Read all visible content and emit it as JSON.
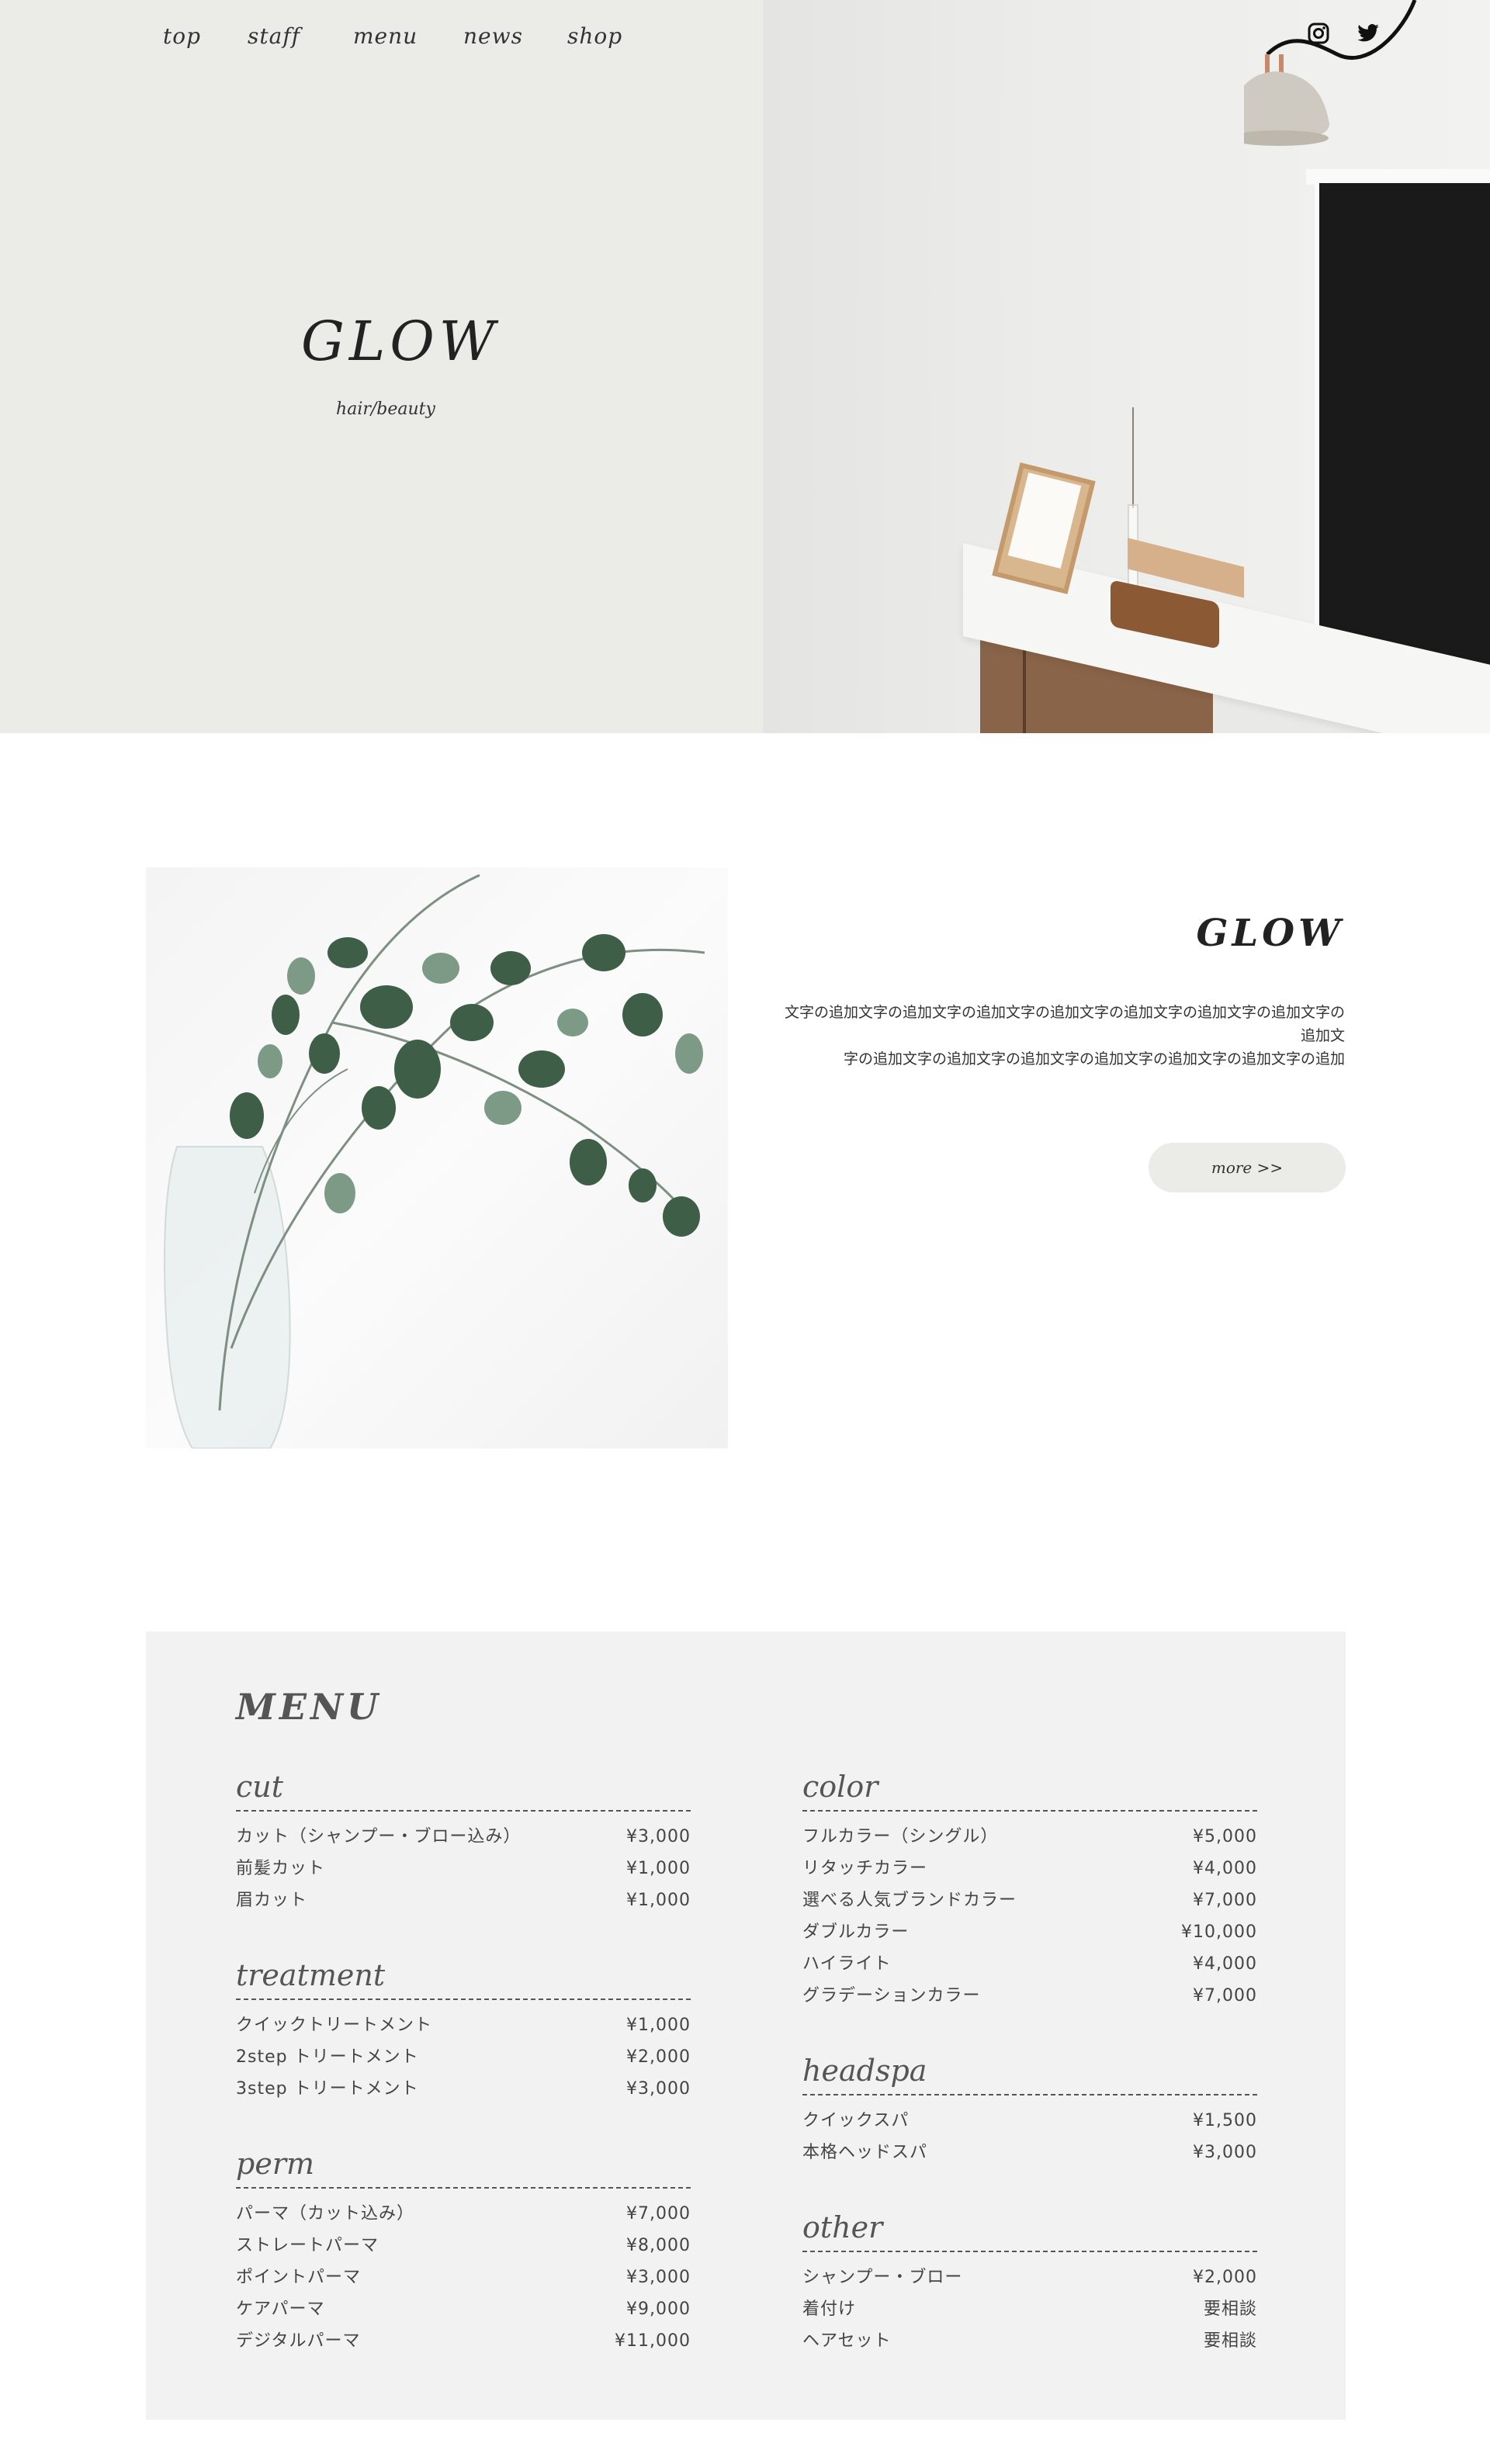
{
  "nav": {
    "items": [
      "top",
      "staff",
      "menu",
      "news",
      "shop"
    ]
  },
  "social": {
    "icons": [
      "instagram-icon",
      "twitter-icon"
    ]
  },
  "hero": {
    "title": "GLOW",
    "subtitle": "hair/beauty"
  },
  "about": {
    "title": "GLOW",
    "text_line1": "文字の追加文字の追加文字の追加文字の追加文字の追加文字の追加文字の追加文字の追加文",
    "text_line2": "字の追加文字の追加文字の追加文字の追加文字の追加文字の追加文字の追加",
    "more_label": "more >>"
  },
  "menu": {
    "heading": "MENU",
    "left": [
      {
        "title": "cut",
        "items": [
          {
            "name": "カット（シャンプー・ブロー込み）",
            "price": "¥3,000"
          },
          {
            "name": "前髪カット",
            "price": "¥1,000"
          },
          {
            "name": "眉カット",
            "price": "¥1,000"
          }
        ]
      },
      {
        "title": "treatment",
        "items": [
          {
            "name": "クイックトリートメント",
            "price": "¥1,000"
          },
          {
            "name": "2step トリートメント",
            "price": "¥2,000"
          },
          {
            "name": "3step トリートメント",
            "price": "¥3,000"
          }
        ]
      },
      {
        "title": "perm",
        "items": [
          {
            "name": "パーマ（カット込み）",
            "price": "¥7,000"
          },
          {
            "name": "ストレートパーマ",
            "price": "¥8,000"
          },
          {
            "name": "ポイントパーマ",
            "price": "¥3,000"
          },
          {
            "name": "ケアパーマ",
            "price": "¥9,000"
          },
          {
            "name": "デジタルパーマ",
            "price": "¥11,000"
          }
        ]
      }
    ],
    "right": [
      {
        "title": "color",
        "items": [
          {
            "name": "フルカラー（シングル）",
            "price": "¥5,000"
          },
          {
            "name": "リタッチカラー",
            "price": "¥4,000"
          },
          {
            "name": "選べる人気ブランドカラー",
            "price": "¥7,000"
          },
          {
            "name": "ダブルカラー",
            "price": "¥10,000"
          },
          {
            "name": "ハイライト",
            "price": "¥4,000"
          },
          {
            "name": "グラデーションカラー",
            "price": "¥7,000"
          }
        ]
      },
      {
        "title": "headspa",
        "items": [
          {
            "name": "クイックスパ",
            "price": "¥1,500"
          },
          {
            "name": "本格ヘッドスパ",
            "price": "¥3,000"
          }
        ]
      },
      {
        "title": "other",
        "items": [
          {
            "name": "シャンプー・ブロー",
            "price": "¥2,000"
          },
          {
            "name": "着付け",
            "price": "要相談"
          },
          {
            "name": "ヘアセット",
            "price": "要相談"
          }
        ]
      }
    ]
  }
}
